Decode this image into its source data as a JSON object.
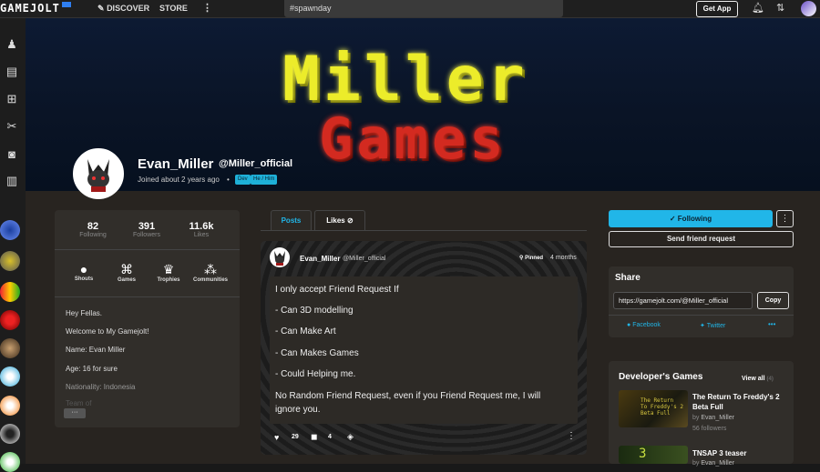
{
  "topbar": {
    "logo": "GAMEJOLT",
    "nav": [
      "DISCOVER",
      "STORE"
    ],
    "search_value": "#spawnday",
    "get_app": "Get App"
  },
  "banner": {
    "line1": "Miller",
    "line2": "Games"
  },
  "profile": {
    "name": "Evan_Miller",
    "handle": "@Miller_official",
    "joined": "Joined about 2 years ago",
    "tags": [
      "Dev",
      "He / Him"
    ]
  },
  "stats": [
    {
      "value": "82",
      "label": "Following"
    },
    {
      "value": "391",
      "label": "Followers"
    },
    {
      "value": "11.6k",
      "label": "Likes"
    }
  ],
  "quick_links": [
    "Shouts",
    "Games",
    "Trophies",
    "Communities"
  ],
  "bio": [
    "Hey Fellas.",
    "Welcome to My Gamejolt!",
    "Name: Evan Miller",
    "Age: 16 for sure",
    "Nationality: Indonesia",
    "Team of"
  ],
  "tabs": {
    "posts": "Posts",
    "likes": "Likes"
  },
  "post": {
    "author": "Evan_Miller",
    "handle": "@Miller_official",
    "pinned": "Pinned",
    "time": "4 months",
    "lines": [
      "I only accept Friend Request If",
      "- Can 3D modelling",
      "- Can Make Art",
      "- Can Makes Games",
      "- Could Helping me.",
      "No Random Friend Request, even if you Friend Request me, I will",
      "ignore you."
    ],
    "likes": "29",
    "comments": "4"
  },
  "actions": {
    "following": "Following",
    "friend_request": "Send friend request"
  },
  "share": {
    "title": "Share",
    "url": "https://gamejolt.com/@Miller_official",
    "copy": "Copy",
    "facebook": "Facebook",
    "twitter": "Twitter"
  },
  "dev_games": {
    "title": "Developer's Games",
    "view_all": "View all",
    "view_all_count": "(4)",
    "games": [
      {
        "title": "The Return To Freddy's 2 Beta Full",
        "by": "by",
        "author": "Evan_Miller",
        "followers": "56 followers"
      },
      {
        "title": "TNSAP 3 teaser",
        "by": "by",
        "author": "Evan_Miller",
        "followers": ""
      }
    ]
  },
  "colors": {
    "accent": "#21b6e8",
    "banner_yellow": "#ecec2a",
    "banner_red": "#d32a20"
  }
}
